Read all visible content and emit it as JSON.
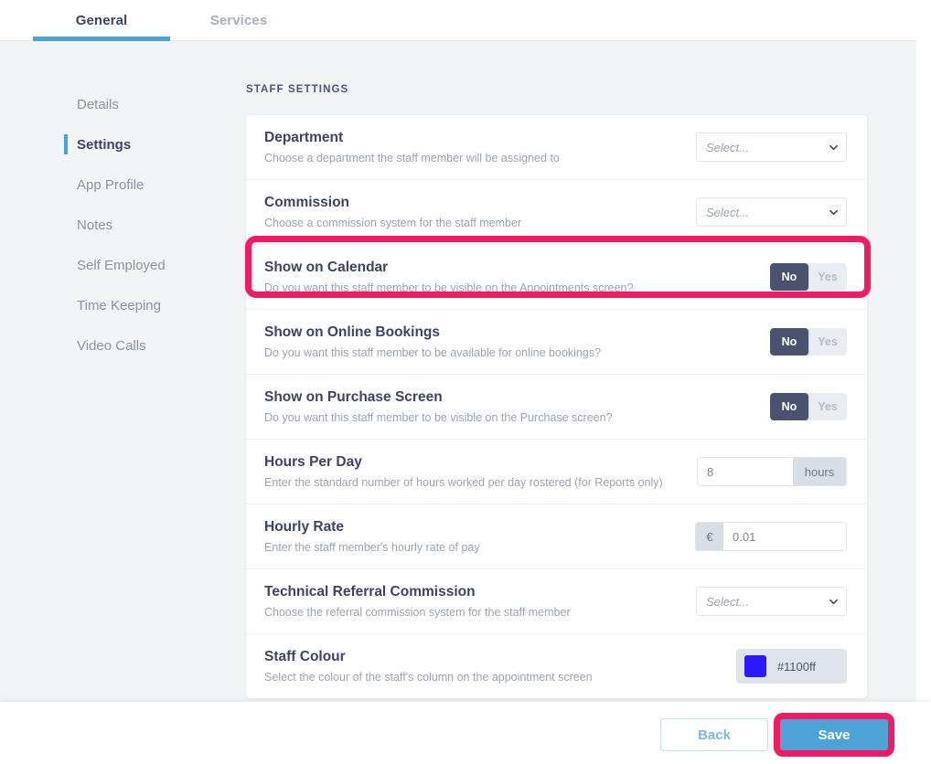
{
  "tabs": [
    {
      "label": "General",
      "active": true
    },
    {
      "label": "Services",
      "active": false
    }
  ],
  "sidebar": {
    "items": [
      {
        "label": "Details"
      },
      {
        "label": "Settings"
      },
      {
        "label": "App Profile"
      },
      {
        "label": "Notes"
      },
      {
        "label": "Self Employed"
      },
      {
        "label": "Time Keeping"
      },
      {
        "label": "Video Calls"
      }
    ]
  },
  "main": {
    "section_title": "STAFF SETTINGS",
    "rows": [
      {
        "title": "Department",
        "description": "Choose a department the staff member will be assigned to",
        "control": "select",
        "value": "Select..."
      },
      {
        "title": "Commission",
        "description": "Choose a commission system for the staff member",
        "control": "select",
        "value": "Select..."
      },
      {
        "title": "Show on Calendar",
        "description": "Do you want this staff member to be visible on the Appointments screen?",
        "control": "toggle",
        "options": [
          "No",
          "Yes"
        ],
        "value": "No"
      },
      {
        "title": "Show on Online Bookings",
        "description": "Do you want this staff member to be available for online bookings?",
        "control": "toggle",
        "options": [
          "No",
          "Yes"
        ],
        "value": "No"
      },
      {
        "title": "Show on Purchase Screen",
        "description": "Do you want this staff member to be visible on the Purchase screen?",
        "control": "toggle",
        "options": [
          "No",
          "Yes"
        ],
        "value": "No"
      },
      {
        "title": "Hours Per Day",
        "description": "Enter the standard number of hours worked per day rostered (for Reports only)",
        "control": "suffix-input",
        "value": "8",
        "suffix": "hours"
      },
      {
        "title": "Hourly Rate",
        "description": "Enter the staff member's hourly rate of pay",
        "control": "prefix-input",
        "value": "0.01",
        "prefix": "€"
      },
      {
        "title": "Technical Referral Commission",
        "description": "Choose the referral commission system for the staff member",
        "control": "select",
        "value": "Select..."
      },
      {
        "title": "Staff Colour",
        "description": "Select the colour of the staff's column on the appointment screen",
        "control": "colour",
        "value": "#1100ff",
        "swatch": "#2b1aff"
      }
    ]
  },
  "footer": {
    "back_label": "Back",
    "save_label": "Save"
  },
  "colors": {
    "accent_blue": "#4da3d6",
    "highlight_pink": "#f21b63",
    "toggle_on": "#4a5270"
  }
}
